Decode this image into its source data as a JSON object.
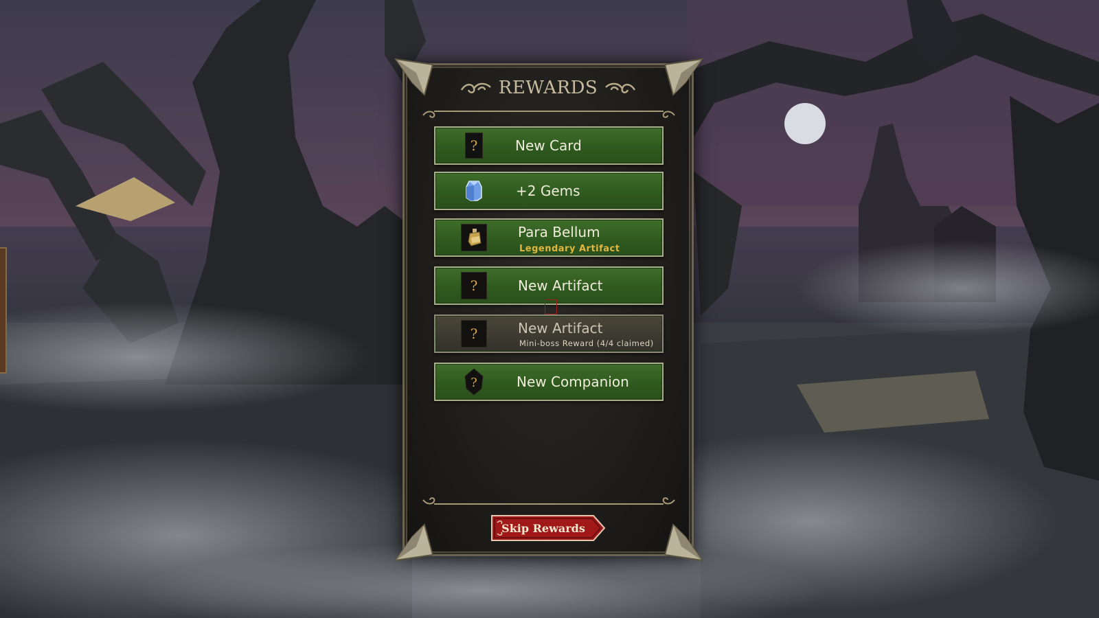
{
  "panel": {
    "title": "REWARDS",
    "rewards": [
      {
        "label": "New Card",
        "sublabel": "",
        "icon": "mystery-card-icon",
        "state": "available"
      },
      {
        "label": "+2 Gems",
        "sublabel": "",
        "icon": "gem-icon",
        "state": "available"
      },
      {
        "label": "Para Bellum",
        "sublabel": "Legendary Artifact",
        "icon": "artifact-flask-icon",
        "state": "available"
      },
      {
        "label": "New Artifact",
        "sublabel": "",
        "icon": "mystery-artifact-icon",
        "state": "available"
      },
      {
        "label": "New Artifact",
        "sublabel": "Mini-boss  Reward  (4/4  claimed)",
        "icon": "mystery-artifact-icon",
        "state": "claimed"
      },
      {
        "label": "New Companion",
        "sublabel": "",
        "icon": "mystery-companion-icon",
        "state": "available"
      }
    ],
    "skip_label": "Skip Rewards"
  },
  "colors": {
    "reward_green": "#2f5a1f",
    "claimed_grey": "#3c392f",
    "legendary_gold": "#e0b640",
    "skip_red": "#a01818"
  }
}
